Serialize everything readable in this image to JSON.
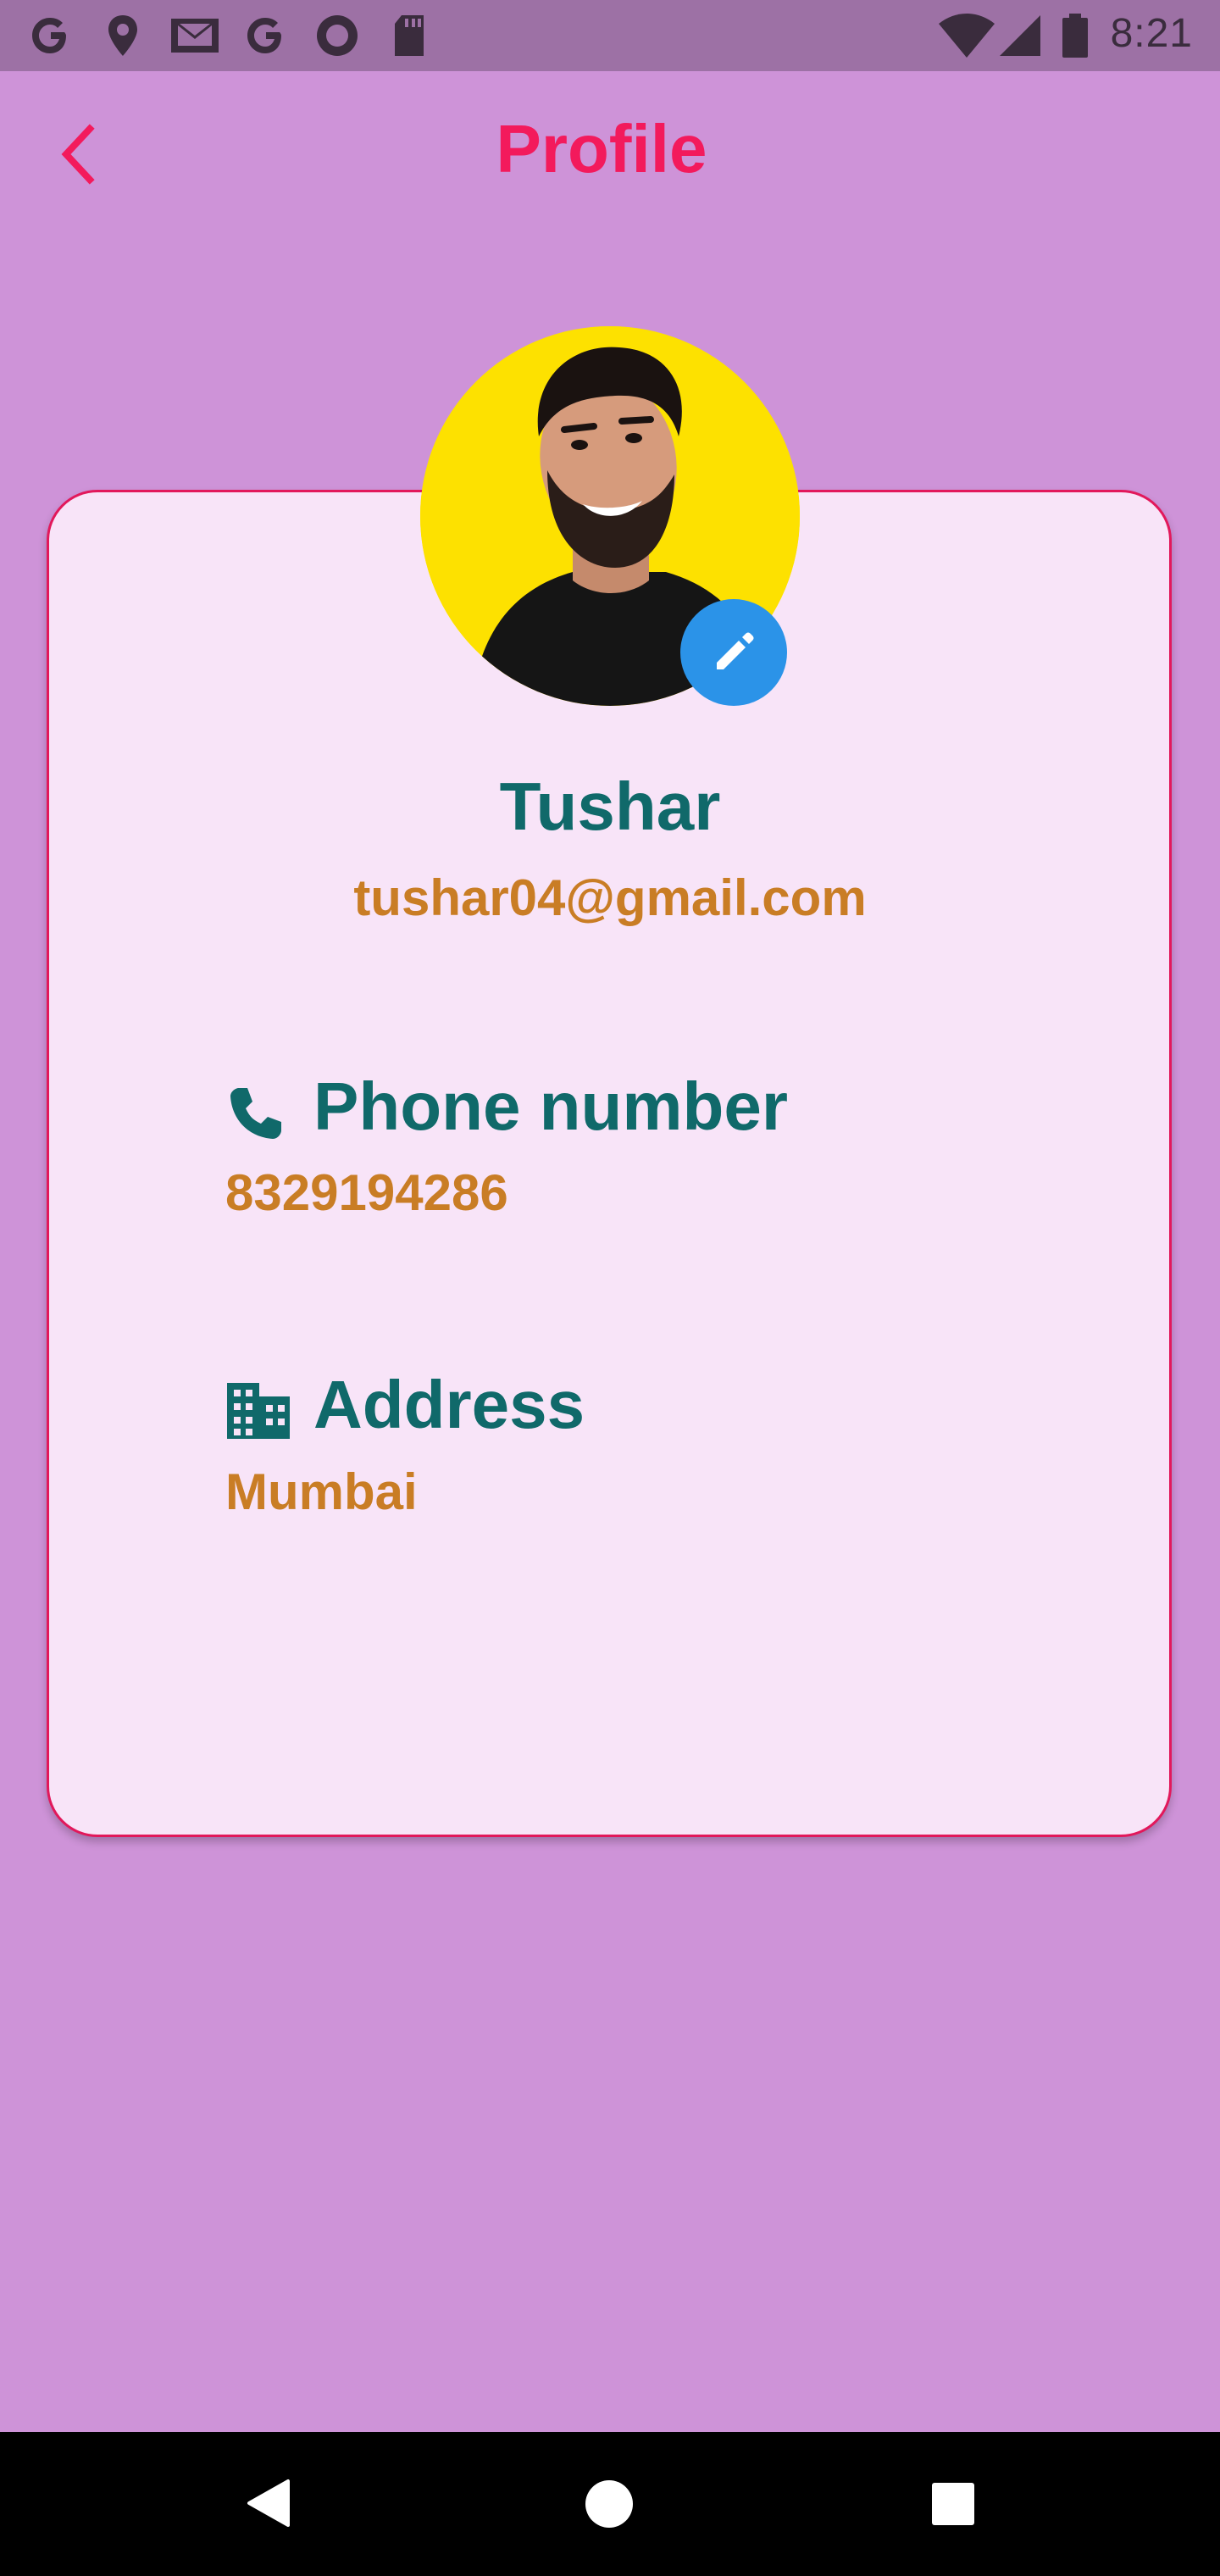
{
  "status_bar": {
    "time": "8:21",
    "left_icons": [
      "google-icon",
      "location-pin-icon",
      "gmail-icon",
      "google-icon",
      "circle-notification-icon",
      "sd-card-icon"
    ],
    "right_icons": [
      "wifi-icon",
      "cellular-signal-icon",
      "battery-icon"
    ]
  },
  "header": {
    "title": "Profile",
    "back_icon": "chevron-left-icon"
  },
  "profile": {
    "name": "Tushar",
    "email": "tushar04@gmail.com",
    "avatar_bg": "#fde100",
    "edit_icon": "pencil-icon"
  },
  "fields": {
    "phone": {
      "label": "Phone number",
      "value": "8329194286",
      "icon": "phone-icon"
    },
    "address": {
      "label": "Address",
      "value": "Mumbai",
      "icon": "building-icon"
    }
  },
  "colors": {
    "background": "#ce93d8",
    "status_bar": "#9d71a5",
    "accent": "#f31a5c",
    "card_bg": "#f8e4f8",
    "label": "#10696a",
    "value": "#c97d25",
    "edit_button": "#2b93e8"
  },
  "nav_bar": {
    "buttons": [
      "back-triangle-icon",
      "home-circle-icon",
      "recents-square-icon"
    ]
  }
}
